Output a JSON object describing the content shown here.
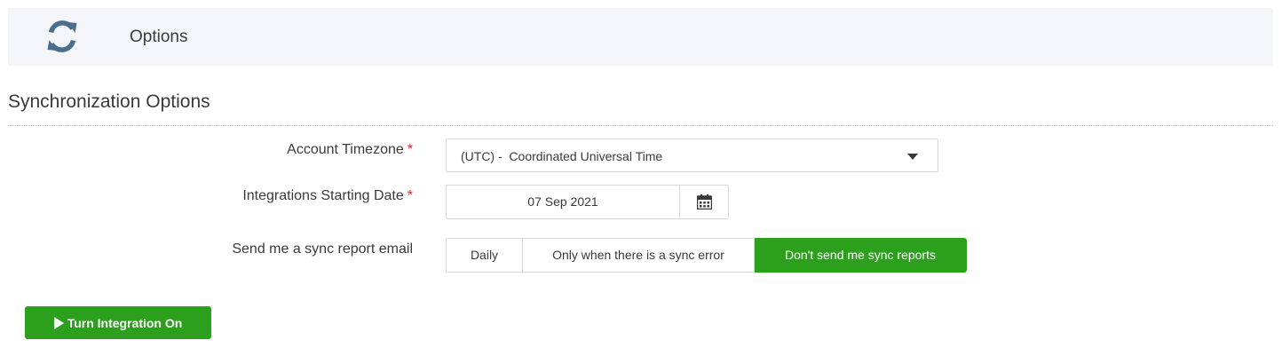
{
  "header": {
    "logo_icon": "sync-arrows-icon",
    "title": "Options"
  },
  "section": {
    "title": "Synchronization Options"
  },
  "fields": {
    "timezone": {
      "label": "Account Timezone",
      "required_mark": "*",
      "value": "(UTC) -  Coordinated Universal Time"
    },
    "start_date": {
      "label": "Integrations Starting Date",
      "required_mark": "*",
      "value": "07 Sep 2021",
      "button_icon": "calendar-icon"
    },
    "sync_report": {
      "label": "Send me a sync report email",
      "options": [
        "Daily",
        "Only when there is a sync error",
        "Don't send me sync reports"
      ],
      "selected": "Don't send me sync reports"
    }
  },
  "actions": {
    "turn_on_label": "Turn Integration On",
    "turn_on_icon": "play-icon"
  },
  "colors": {
    "accent": "#2ca01c",
    "logo": "#4a6f8e",
    "header_bg": "#f4f5f8",
    "required": "#d52b1e"
  }
}
